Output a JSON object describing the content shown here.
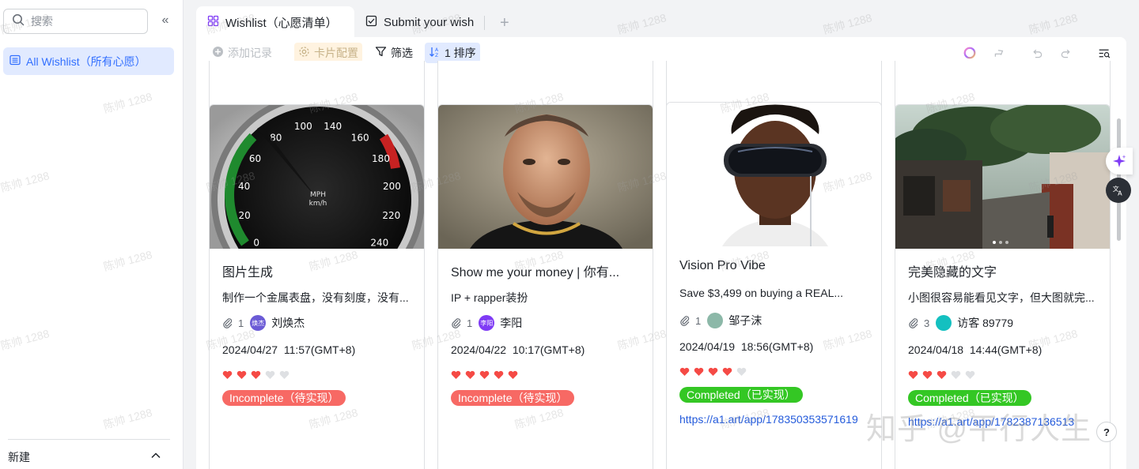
{
  "sidebar": {
    "search_placeholder": "搜索",
    "items": [
      {
        "label": "All Wishlist（所有心愿）"
      }
    ],
    "footer_label": "新建"
  },
  "tabs": [
    {
      "label": "Wishlist（心愿清单）",
      "active": true,
      "icon": "grid-icon"
    },
    {
      "label": "Submit your wish",
      "active": false,
      "icon": "form-icon"
    }
  ],
  "toolbar": {
    "add_record": "添加记录",
    "card_config": "卡片配置",
    "filter": "筛选",
    "sort": "1 排序"
  },
  "cards": [
    {
      "title": "图片生成",
      "desc": "制作一个金属表盘，没有刻度，没有...",
      "attachments": "1",
      "avatar_text": "焕杰",
      "avatar_color": "#6b5bd6",
      "user": "刘焕杰",
      "date": "2024/04/27  11:57(GMT+8)",
      "rating": 3,
      "status": "Incomplete（待实现）",
      "status_type": "incomplete",
      "link": "",
      "gauge": {
        "labels": [
          "0",
          "20",
          "40",
          "60",
          "80",
          "100",
          "140",
          "160",
          "180",
          "200",
          "220",
          "240"
        ],
        "unit_top": "MPH",
        "unit_bottom": "km/h"
      }
    },
    {
      "title": "Show me your money | 你有...",
      "desc": "IP + rapper装扮",
      "attachments": "1",
      "avatar_text": "李阳",
      "avatar_color": "#7f3bf5",
      "user": "李阳",
      "date": "2024/04/22  10:17(GMT+8)",
      "rating": 5,
      "status": "Incomplete（待实现）",
      "status_type": "incomplete",
      "link": ""
    },
    {
      "title": "Vision Pro Vibe",
      "desc": "Save $3,499 on buying a REAL...",
      "attachments": "1",
      "avatar_text": "",
      "avatar_color": "#8cb8a8",
      "user": "邹子沫",
      "date": "2024/04/19  18:56(GMT+8)",
      "rating": 4,
      "status": "Completed（已实现）",
      "status_type": "completed",
      "link": "https://a1.art/app/178350353571619"
    },
    {
      "title": "完美隐藏的文字",
      "desc": "小图很容易能看见文字，但大图就完...",
      "attachments": "3",
      "avatar_text": "",
      "avatar_color": "#14c0c0",
      "user": "访客 89779",
      "date": "2024/04/18  14:44(GMT+8)",
      "rating": 3,
      "status": "Completed（已实现）",
      "status_type": "completed",
      "link": "https://a1.art/app/1782387136513"
    }
  ],
  "watermark_text": "陈帅 1288",
  "brand_watermark": "知乎 @平行人生",
  "colors": {
    "accent": "#3370ff",
    "heart_on": "#f54a45",
    "heart_off": "#dee0e3",
    "incomplete": "#f76964",
    "completed": "#34c724"
  }
}
